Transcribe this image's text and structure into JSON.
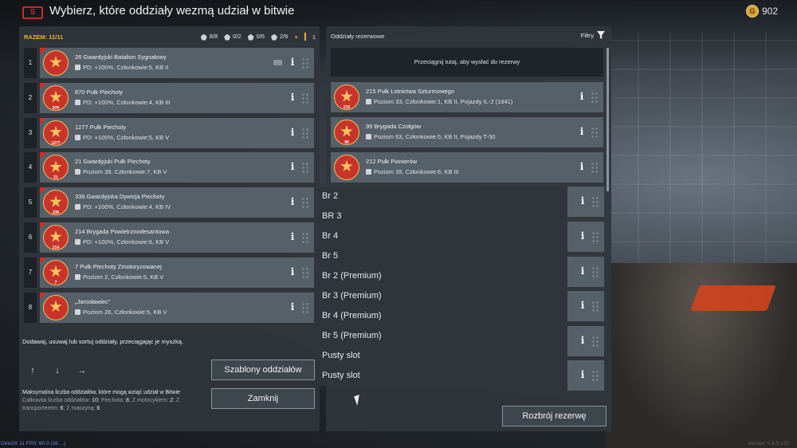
{
  "header": {
    "logo_text": "S",
    "title": "Wybierz, które oddziały wezmą udział w bitwie",
    "gold": "902"
  },
  "left": {
    "razem": "RAZEM: 11/11",
    "counts": [
      {
        "icon": "infantry-icon",
        "value": "8/8"
      },
      {
        "icon": "paratrooper-icon",
        "value": "0/2"
      },
      {
        "icon": "motorcycle-icon",
        "value": "0/6"
      },
      {
        "icon": "transport-icon",
        "value": "2/6"
      },
      {
        "icon": "vehicle-icon",
        "value": "1"
      }
    ],
    "plus": "+",
    "squads": [
      {
        "num": "1",
        "emblem": "",
        "name": "26 Gwardyjski Batalion Sygnałowy",
        "sub": "PD: +100%, Członkowie:5, KB II"
      },
      {
        "num": "2",
        "emblem": "870",
        "name": "870 Pułk Piechoty",
        "sub": "PD: +100%, Członkowie:4, KB III"
      },
      {
        "num": "3",
        "emblem": "1277",
        "name": "1277 Pułk Piechoty",
        "sub": "PD: +100%, Członkowie:5, KB V"
      },
      {
        "num": "4",
        "emblem": "21",
        "name": "21 Gwardyjski Pułk Piechoty",
        "sub": "Poziom 39, Członkowie:7, KB V"
      },
      {
        "num": "5",
        "emblem": "336",
        "name": "336 Gwardyjska Dywizja Piechoty",
        "sub": "PD: +100%, Członkowie:4, KB IV"
      },
      {
        "num": "6",
        "emblem": "214",
        "name": "214 Brygada Powietrznodesantowa",
        "sub": "PD: +100%, Członkowie:6, KB V"
      },
      {
        "num": "7",
        "emblem": "7",
        "name": "7 Pułk Piechoty Zmotoryzowanej",
        "sub": "Poziom 2, Członkowie:5, KB V"
      },
      {
        "num": "8",
        "emblem": "",
        "name": "„Jarosławiec”",
        "sub": "Poziom 26, Członkowie:5, KB V"
      }
    ],
    "hint": "Dodawaj, usuwaj lub sortuj oddziały, przeciągając je myszką.",
    "btn_templates": "Szablony oddziałów",
    "btn_close": "Zamknij",
    "max_title": "Maksymalna liczba oddziałów, które mogą wziąć udział w Bitwie",
    "max_line1": "Całkowita liczba oddziałów:",
    "max_total": "10",
    "max_inf_label": "; Piechota:",
    "max_inf": "8",
    "max_moto_label": "; Z motocyklem:",
    "max_moto": "2",
    "max_trans_label": "; Z transporterem:",
    "max_trans": "6",
    "max_mach_label": "; Z maszyną:",
    "max_mach": "6"
  },
  "right": {
    "title": "Oddziały rezerwowe",
    "filters": "Filtry",
    "drop_zone": "Przeciągnij tutaj, aby wysłać do rezerwy",
    "squads": [
      {
        "emblem": "215",
        "name": "215 Pułk Lotnictwa Szturmowego",
        "sub": "Poziom 33, Członkowie:1, KB II, Pojazdy IL-2 (1941)"
      },
      {
        "emblem": "99",
        "name": "99 Brygada Czołgów",
        "sub": "Poziom 63, Członkowie:5, KB II, Pojazdy T-50"
      },
      {
        "emblem": "",
        "name": "212 Pułk Pionierów",
        "sub": "Poziom 39, Członkowie:6, KB III"
      }
    ],
    "btn_rearm": "Rozbrój rezerwę"
  },
  "dropdown": {
    "items": [
      "Br 2",
      "BR 3",
      "Br 4",
      "Br 5",
      "Br 2 (Premium)",
      "Br 3 (Premium)",
      "Br 4 (Premium)",
      "Br 5 (Premium)",
      "Pusty slot",
      "Pusty slot"
    ]
  },
  "footer": {
    "fps": "DirectX 11 FPS: 60.0 (16 ...)",
    "version": "version: 0.6.5.128"
  }
}
